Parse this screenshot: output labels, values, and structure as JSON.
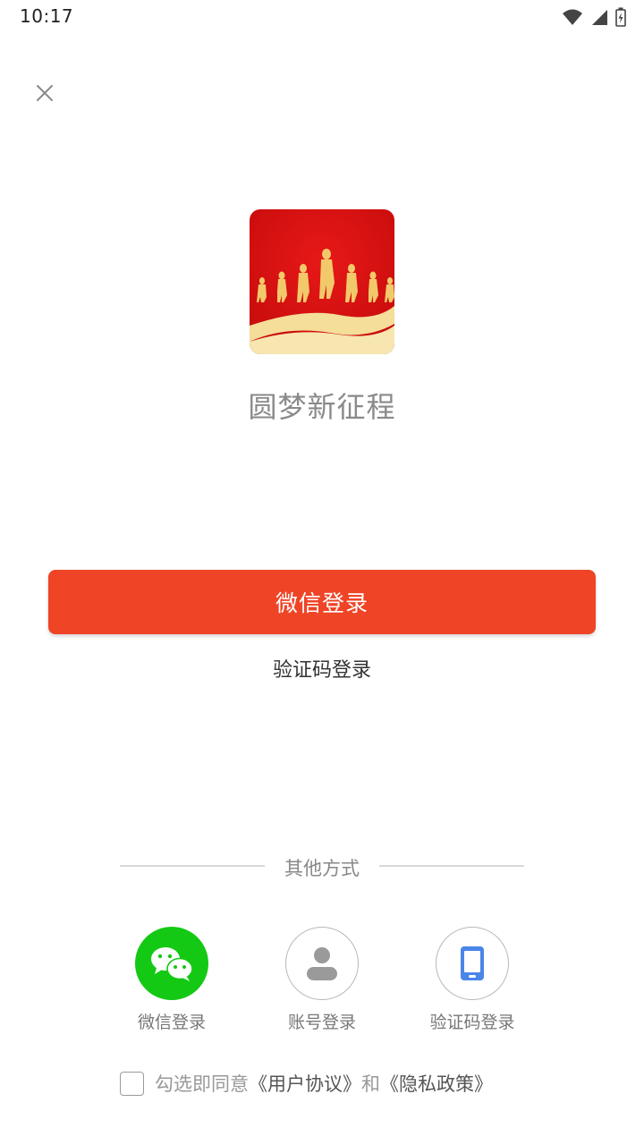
{
  "status_bar": {
    "time": "10:17",
    "icons": [
      "wifi-icon",
      "cell-signal-icon",
      "battery-charging-icon"
    ]
  },
  "app": {
    "name": "圆梦新征程"
  },
  "primary_button": {
    "label": "微信登录",
    "color": "#ef4426"
  },
  "code_login_link": {
    "label": "验证码登录"
  },
  "other_methods": {
    "divider_label": "其他方式",
    "options": [
      {
        "label": "微信登录",
        "icon": "wechat-icon",
        "color": "#14c914"
      },
      {
        "label": "账号登录",
        "icon": "user-icon",
        "color": "#9a9a9a"
      },
      {
        "label": "验证码登录",
        "icon": "phone-icon",
        "color": "#4a86e8"
      }
    ]
  },
  "agreement": {
    "checked": false,
    "prefix": "勾选即同意",
    "user_agreement": "《用户协议》",
    "and": "和",
    "privacy_policy": "《隐私政策》"
  }
}
